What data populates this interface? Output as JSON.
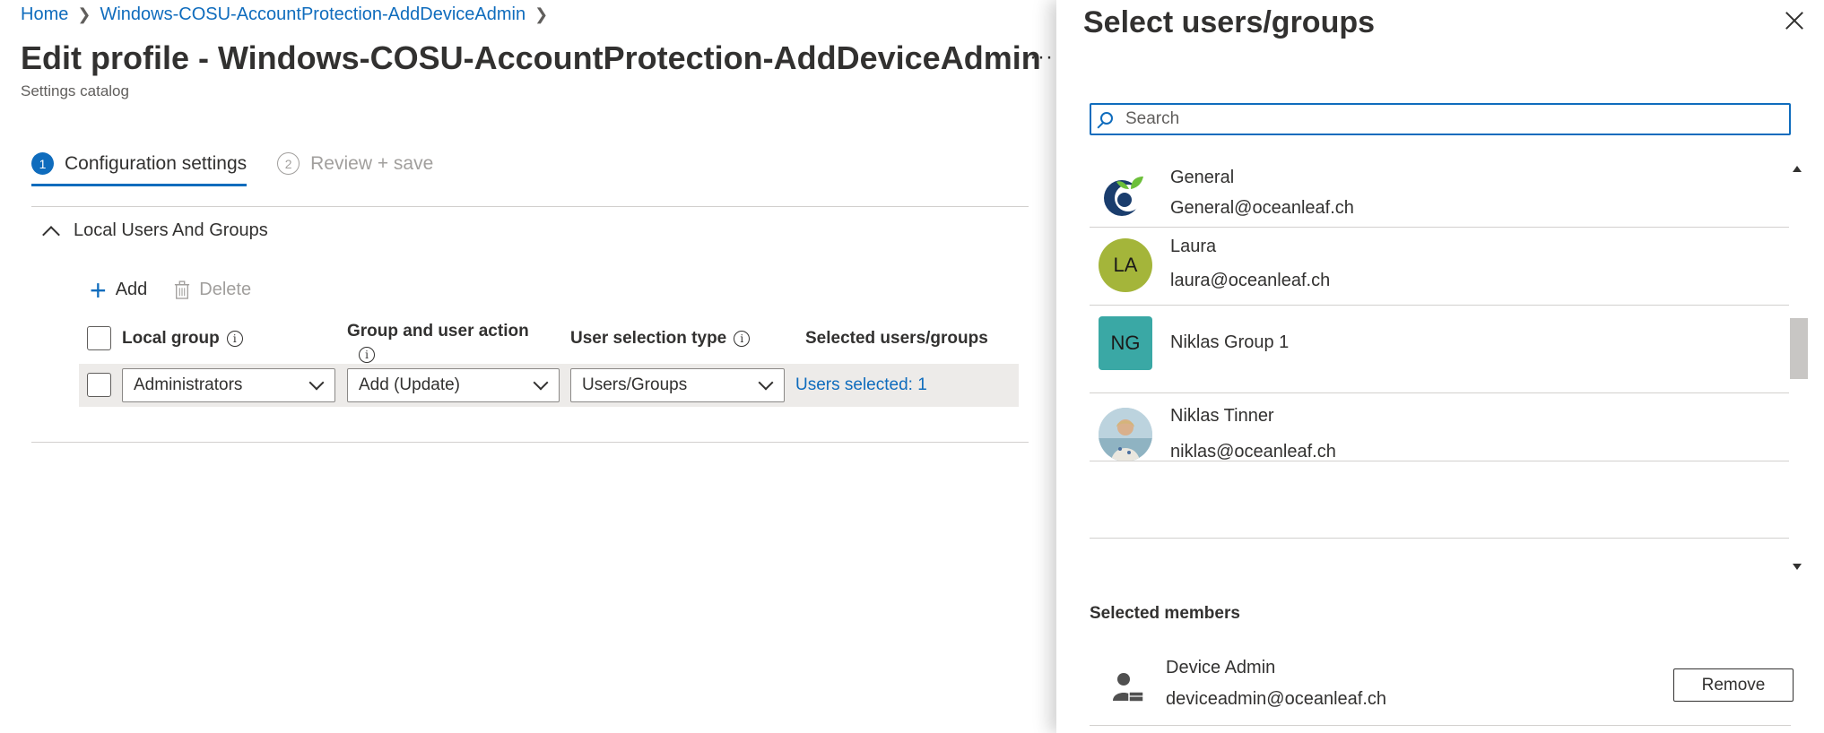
{
  "breadcrumb": {
    "home": "Home",
    "profile": "Windows-COSU-AccountProtection-AddDeviceAdmin"
  },
  "page": {
    "title": "Edit profile - Windows-COSU-AccountProtection-AddDeviceAdmin",
    "subtitle": "Settings catalog",
    "more_label": "···"
  },
  "steps": [
    {
      "num": "1",
      "label": "Configuration settings",
      "active": true
    },
    {
      "num": "2",
      "label": "Review + save",
      "active": false
    }
  ],
  "section": {
    "title": "Local Users And Groups"
  },
  "toolbar": {
    "add_label": "Add",
    "delete_label": "Delete"
  },
  "table": {
    "headers": {
      "local_group": "Local group",
      "group_action": "Group and user action",
      "selection_type": "User selection type",
      "selected": "Selected users/groups"
    },
    "row": {
      "local_group": "Administrators",
      "group_action": "Add (Update)",
      "selection_type": "Users/Groups",
      "selected": "Users selected: 1"
    }
  },
  "panel": {
    "title": "Select users/groups",
    "search_placeholder": "Search",
    "items": [
      {
        "name": "General",
        "email": "General@oceanleaf.ch",
        "avatar": "logo"
      },
      {
        "name": "Laura",
        "email": "laura@oceanleaf.ch",
        "initials": "LA",
        "avatar_color": "#a4b53a"
      },
      {
        "name": "Niklas Group 1",
        "email": "",
        "initials": "NG",
        "avatar_color": "#3aa8a5"
      },
      {
        "name": "Niklas Tinner",
        "email": "niklas@oceanleaf.ch",
        "avatar": "photo"
      }
    ],
    "selected_label": "Selected members",
    "selected_members": [
      {
        "name": "Device Admin",
        "email": "deviceadmin@oceanleaf.ch",
        "remove_label": "Remove"
      }
    ]
  },
  "colors": {
    "accent": "#0f6cbd",
    "row_bg": "#edebe9"
  }
}
